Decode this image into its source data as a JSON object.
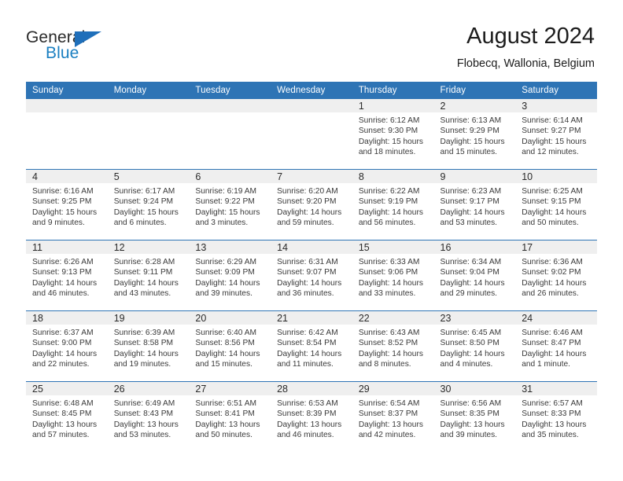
{
  "brand": {
    "name_top": "General",
    "name_bottom": "Blue",
    "accent_color": "#1f6fba"
  },
  "header": {
    "title": "August 2024",
    "subtitle": "Flobecq, Wallonia, Belgium"
  },
  "theme": {
    "header_blue": "#2e74b5",
    "date_band_gray": "#efefef",
    "text_color": "#3a3a3a"
  },
  "weekday_headers": [
    "Sunday",
    "Monday",
    "Tuesday",
    "Wednesday",
    "Thursday",
    "Friday",
    "Saturday"
  ],
  "labels": {
    "sunrise_prefix": "Sunrise:",
    "sunset_prefix": "Sunset:",
    "daylight_prefix": "Daylight:"
  },
  "weeks": [
    [
      {
        "day": "",
        "empty": true
      },
      {
        "day": "",
        "empty": true
      },
      {
        "day": "",
        "empty": true
      },
      {
        "day": "",
        "empty": true
      },
      {
        "day": "1",
        "sunrise": "Sunrise: 6:12 AM",
        "sunset": "Sunset: 9:30 PM",
        "daylight": "Daylight: 15 hours and 18 minutes."
      },
      {
        "day": "2",
        "sunrise": "Sunrise: 6:13 AM",
        "sunset": "Sunset: 9:29 PM",
        "daylight": "Daylight: 15 hours and 15 minutes."
      },
      {
        "day": "3",
        "sunrise": "Sunrise: 6:14 AM",
        "sunset": "Sunset: 9:27 PM",
        "daylight": "Daylight: 15 hours and 12 minutes."
      }
    ],
    [
      {
        "day": "4",
        "sunrise": "Sunrise: 6:16 AM",
        "sunset": "Sunset: 9:25 PM",
        "daylight": "Daylight: 15 hours and 9 minutes."
      },
      {
        "day": "5",
        "sunrise": "Sunrise: 6:17 AM",
        "sunset": "Sunset: 9:24 PM",
        "daylight": "Daylight: 15 hours and 6 minutes."
      },
      {
        "day": "6",
        "sunrise": "Sunrise: 6:19 AM",
        "sunset": "Sunset: 9:22 PM",
        "daylight": "Daylight: 15 hours and 3 minutes."
      },
      {
        "day": "7",
        "sunrise": "Sunrise: 6:20 AM",
        "sunset": "Sunset: 9:20 PM",
        "daylight": "Daylight: 14 hours and 59 minutes."
      },
      {
        "day": "8",
        "sunrise": "Sunrise: 6:22 AM",
        "sunset": "Sunset: 9:19 PM",
        "daylight": "Daylight: 14 hours and 56 minutes."
      },
      {
        "day": "9",
        "sunrise": "Sunrise: 6:23 AM",
        "sunset": "Sunset: 9:17 PM",
        "daylight": "Daylight: 14 hours and 53 minutes."
      },
      {
        "day": "10",
        "sunrise": "Sunrise: 6:25 AM",
        "sunset": "Sunset: 9:15 PM",
        "daylight": "Daylight: 14 hours and 50 minutes."
      }
    ],
    [
      {
        "day": "11",
        "sunrise": "Sunrise: 6:26 AM",
        "sunset": "Sunset: 9:13 PM",
        "daylight": "Daylight: 14 hours and 46 minutes."
      },
      {
        "day": "12",
        "sunrise": "Sunrise: 6:28 AM",
        "sunset": "Sunset: 9:11 PM",
        "daylight": "Daylight: 14 hours and 43 minutes."
      },
      {
        "day": "13",
        "sunrise": "Sunrise: 6:29 AM",
        "sunset": "Sunset: 9:09 PM",
        "daylight": "Daylight: 14 hours and 39 minutes."
      },
      {
        "day": "14",
        "sunrise": "Sunrise: 6:31 AM",
        "sunset": "Sunset: 9:07 PM",
        "daylight": "Daylight: 14 hours and 36 minutes."
      },
      {
        "day": "15",
        "sunrise": "Sunrise: 6:33 AM",
        "sunset": "Sunset: 9:06 PM",
        "daylight": "Daylight: 14 hours and 33 minutes."
      },
      {
        "day": "16",
        "sunrise": "Sunrise: 6:34 AM",
        "sunset": "Sunset: 9:04 PM",
        "daylight": "Daylight: 14 hours and 29 minutes."
      },
      {
        "day": "17",
        "sunrise": "Sunrise: 6:36 AM",
        "sunset": "Sunset: 9:02 PM",
        "daylight": "Daylight: 14 hours and 26 minutes."
      }
    ],
    [
      {
        "day": "18",
        "sunrise": "Sunrise: 6:37 AM",
        "sunset": "Sunset: 9:00 PM",
        "daylight": "Daylight: 14 hours and 22 minutes."
      },
      {
        "day": "19",
        "sunrise": "Sunrise: 6:39 AM",
        "sunset": "Sunset: 8:58 PM",
        "daylight": "Daylight: 14 hours and 19 minutes."
      },
      {
        "day": "20",
        "sunrise": "Sunrise: 6:40 AM",
        "sunset": "Sunset: 8:56 PM",
        "daylight": "Daylight: 14 hours and 15 minutes."
      },
      {
        "day": "21",
        "sunrise": "Sunrise: 6:42 AM",
        "sunset": "Sunset: 8:54 PM",
        "daylight": "Daylight: 14 hours and 11 minutes."
      },
      {
        "day": "22",
        "sunrise": "Sunrise: 6:43 AM",
        "sunset": "Sunset: 8:52 PM",
        "daylight": "Daylight: 14 hours and 8 minutes."
      },
      {
        "day": "23",
        "sunrise": "Sunrise: 6:45 AM",
        "sunset": "Sunset: 8:50 PM",
        "daylight": "Daylight: 14 hours and 4 minutes."
      },
      {
        "day": "24",
        "sunrise": "Sunrise: 6:46 AM",
        "sunset": "Sunset: 8:47 PM",
        "daylight": "Daylight: 14 hours and 1 minute."
      }
    ],
    [
      {
        "day": "25",
        "sunrise": "Sunrise: 6:48 AM",
        "sunset": "Sunset: 8:45 PM",
        "daylight": "Daylight: 13 hours and 57 minutes."
      },
      {
        "day": "26",
        "sunrise": "Sunrise: 6:49 AM",
        "sunset": "Sunset: 8:43 PM",
        "daylight": "Daylight: 13 hours and 53 minutes."
      },
      {
        "day": "27",
        "sunrise": "Sunrise: 6:51 AM",
        "sunset": "Sunset: 8:41 PM",
        "daylight": "Daylight: 13 hours and 50 minutes."
      },
      {
        "day": "28",
        "sunrise": "Sunrise: 6:53 AM",
        "sunset": "Sunset: 8:39 PM",
        "daylight": "Daylight: 13 hours and 46 minutes."
      },
      {
        "day": "29",
        "sunrise": "Sunrise: 6:54 AM",
        "sunset": "Sunset: 8:37 PM",
        "daylight": "Daylight: 13 hours and 42 minutes."
      },
      {
        "day": "30",
        "sunrise": "Sunrise: 6:56 AM",
        "sunset": "Sunset: 8:35 PM",
        "daylight": "Daylight: 13 hours and 39 minutes."
      },
      {
        "day": "31",
        "sunrise": "Sunrise: 6:57 AM",
        "sunset": "Sunset: 8:33 PM",
        "daylight": "Daylight: 13 hours and 35 minutes."
      }
    ]
  ]
}
